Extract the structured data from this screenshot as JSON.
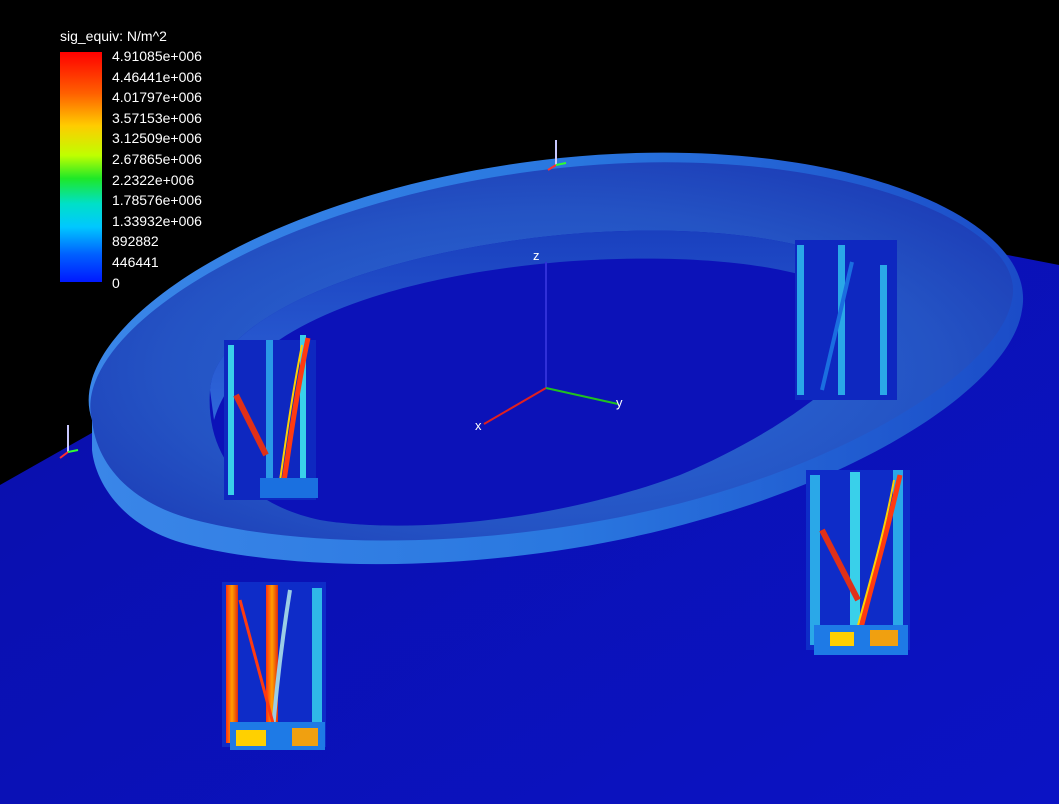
{
  "legend": {
    "title": "sig_equiv: N/m^2",
    "values": [
      "4.91085e+006",
      "4.46441e+006",
      "4.01797e+006",
      "3.57153e+006",
      "3.12509e+006",
      "2.67865e+006",
      "2.2322e+006",
      "1.78576e+006",
      "1.33932e+006",
      "892882",
      "446441",
      "0"
    ]
  },
  "axes": {
    "x": "x",
    "y": "y",
    "z": "z"
  },
  "colors": {
    "background": "#000000",
    "floor": "#0b0fb0",
    "ring": "#2a64d2",
    "high_stress": "#e02a10",
    "low_stress": "#0a18c8"
  }
}
